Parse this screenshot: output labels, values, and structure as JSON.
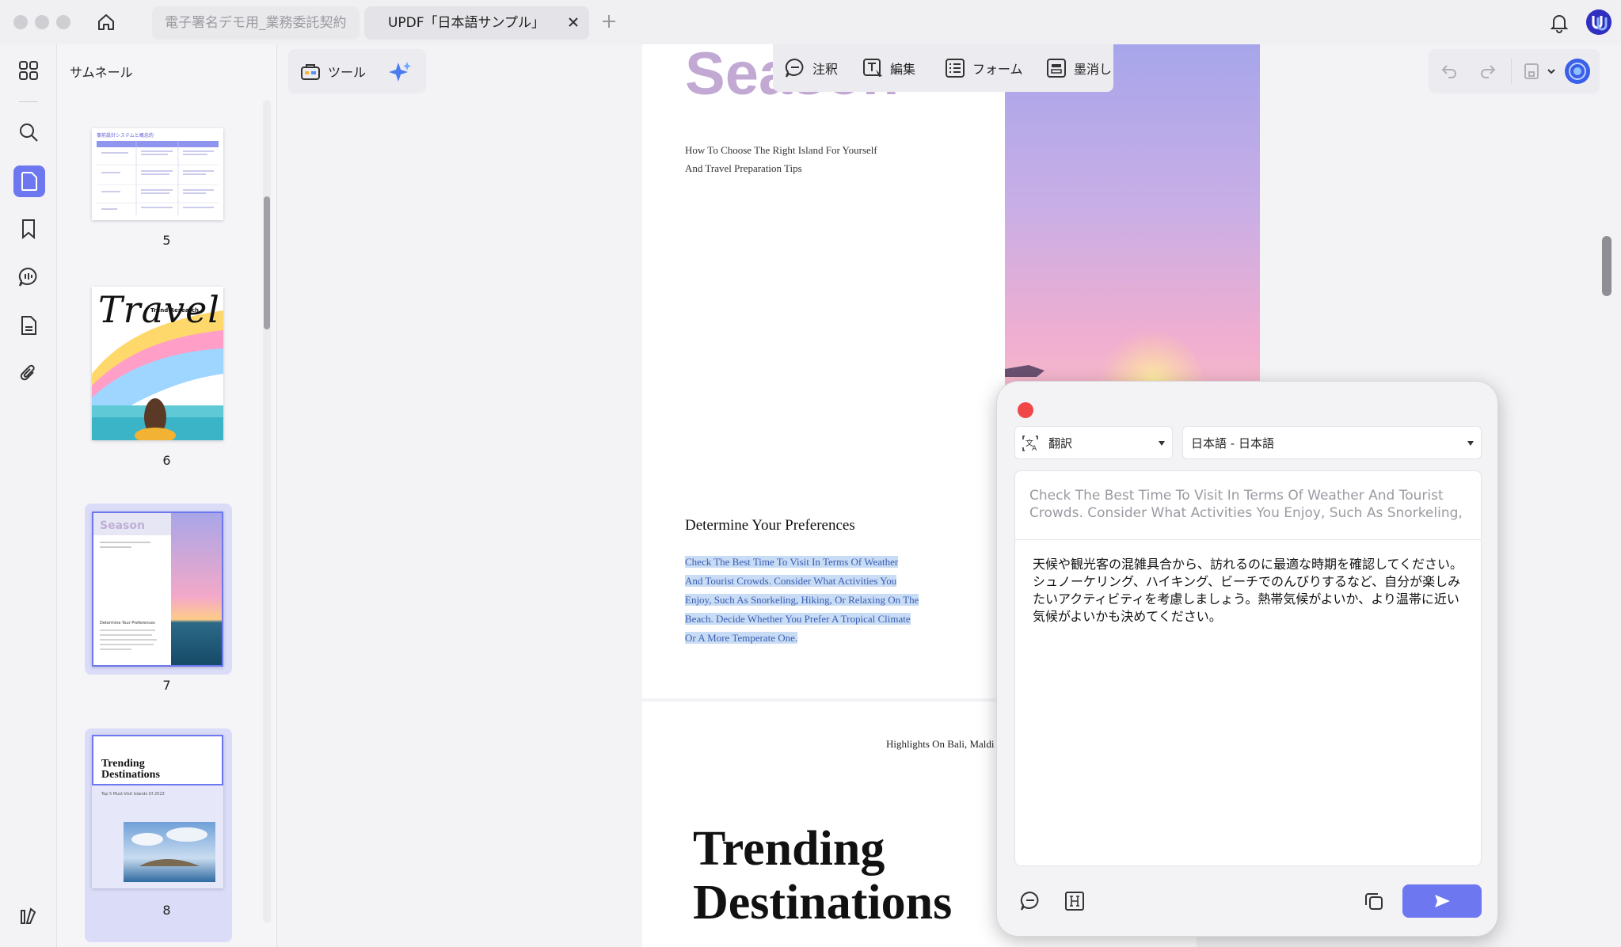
{
  "tabs": [
    {
      "label": "電子署名デモ用_業務委託契約"
    },
    {
      "label": "UPDF「日本語サンプル」"
    }
  ],
  "thumbnails": {
    "title": "サムネール",
    "pages": [
      {
        "number": "5",
        "caption": "事前設計システムと概念的"
      },
      {
        "number": "6",
        "title": "Travel",
        "subtitle": "Trend Research"
      },
      {
        "number": "7",
        "title": "Season",
        "heading": "Determine Your Preferences"
      },
      {
        "number": "8",
        "title": "Trending Destinations",
        "subtitle": "Top 5 Must-Visit Islands Of 2023"
      }
    ]
  },
  "toolbar": {
    "tools_label": "ツール",
    "annotate_label": "注釈",
    "edit_label": "編集",
    "form_label": "フォーム",
    "redact_label": "墨消し"
  },
  "document": {
    "season_title": "Season",
    "subtitle_line1": "How To Choose The Right Island For Yourself",
    "subtitle_line2": "And Travel Preparation Tips",
    "heading": "Determine Your Preferences",
    "body_lines": [
      "Check The Best Time To Visit In Terms Of Weather",
      "And Tourist Crowds. Consider What Activities You",
      "Enjoy, Such As Snorkeling, Hiking, Or Relaxing On The",
      "Beach. Decide Whether You Prefer A Tropical Climate",
      "Or A More Temperate One."
    ],
    "page2_header": "Highlights On Bali, Maldi",
    "page2_title_line1": "Trending",
    "page2_title_line2": "Destinations"
  },
  "translate": {
    "mode_label": "翻訳",
    "language_label": "日本語 - 日本語",
    "source_text": "Check The Best Time To Visit In Terms Of Weather And Tourist Crowds. Consider What Activities You Enjoy, Such As Snorkeling,",
    "result_text": "天候や観光客の混雑具合から、訪れるのに最適な時期を確認してください。シュノーケリング、ハイキング、ビーチでのんびりするなど、自分が楽しみたいアクティビティを考慮しましょう。熱帯気候がよいか、より温帯に近い気候がよいかも決めてください。"
  },
  "colors": {
    "accent": "#6d77f0",
    "highlight": "#c8dcf6",
    "close_dot": "#f04848"
  }
}
